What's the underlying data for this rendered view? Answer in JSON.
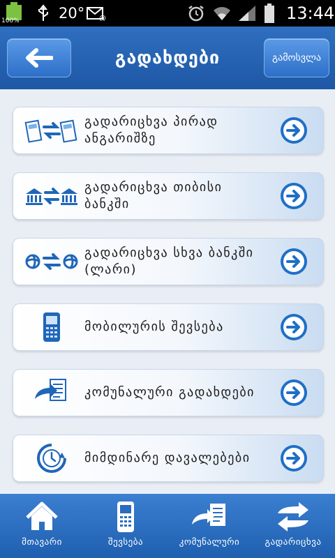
{
  "status_bar": {
    "battery_left": "100%",
    "temperature": "20°",
    "time": "13:44"
  },
  "header": {
    "title": "გადახდები",
    "logout_label": "გამოსვლა"
  },
  "menu": {
    "items": [
      {
        "label_line1": "გადარიცხვა პირად",
        "label_line2": "ანგარიშზე"
      },
      {
        "label_line1": "გადარიცხვა თიბისი",
        "label_line2": "ბანკში"
      },
      {
        "label_line1": "გადარიცხვა სხვა ბანკში",
        "label_line2": "(ლარი)"
      },
      {
        "label_line1": "მობილურის შევსება",
        "label_line2": ""
      },
      {
        "label_line1": "კომუნალური გადახდები",
        "label_line2": ""
      },
      {
        "label_line1": "მიმდინარე დავალებები",
        "label_line2": ""
      }
    ]
  },
  "bottom_nav": {
    "items": [
      {
        "label": "მთავარი",
        "icon": "home-icon"
      },
      {
        "label": "შევსება",
        "icon": "mobile-phone-icon"
      },
      {
        "label": "კომუნალური",
        "icon": "utility-bill-icon"
      },
      {
        "label": "გადარიცხვა",
        "icon": "transfer-arrows-icon"
      }
    ]
  },
  "colors": {
    "header_blue": "#1e57a6",
    "accent_blue": "#1f6fc6",
    "nav_blue": "#2a6cc0"
  }
}
